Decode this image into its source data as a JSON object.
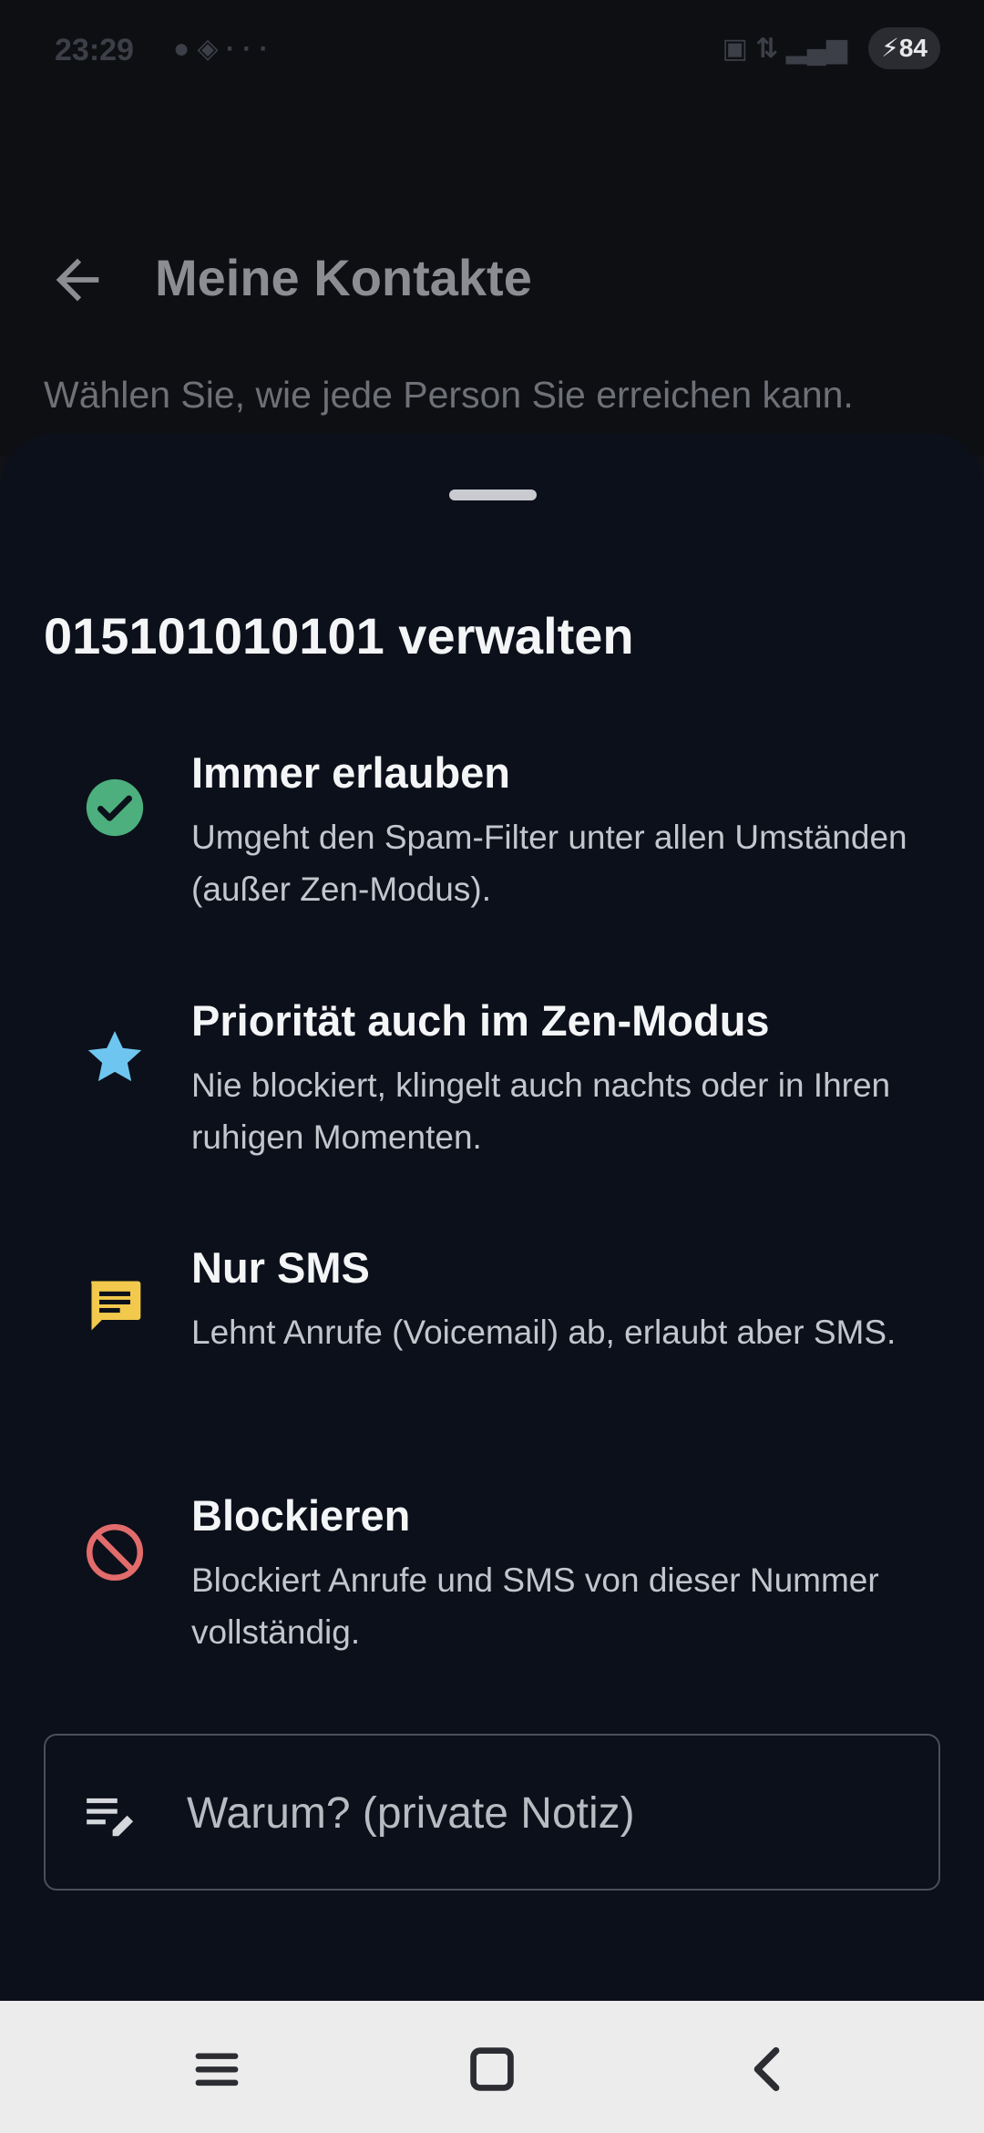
{
  "status_bar": {
    "time": "23:29",
    "battery": "84",
    "battery_icon": "bolt-icon"
  },
  "header": {
    "back_icon": "arrow-left-icon",
    "title": "Meine Kontakte",
    "subtitle": "Wählen Sie, wie jede Person Sie erreichen kann."
  },
  "sheet": {
    "title": "015101010101 verwalten",
    "options": [
      {
        "icon": "check-circle-icon",
        "title": "Immer erlauben",
        "description": "Umgeht den Spam-Filter unter allen Umständen (außer Zen-Modus).",
        "color": "#4caf7d"
      },
      {
        "icon": "star-icon",
        "title": "Priorität auch im Zen-Modus",
        "description": "Nie blockiert, klingelt auch nachts oder in Ihren ruhigen Momenten.",
        "color": "#6ec6f0"
      },
      {
        "icon": "message-icon",
        "title": "Nur SMS",
        "description": "Lehnt Anrufe (Voicemail) ab, erlaubt aber SMS.",
        "color": "#f2c94c"
      },
      {
        "icon": "block-icon",
        "title": "Blockieren",
        "description": "Blockiert Anrufe und SMS von dieser Nummer vollständig.",
        "color": "#e26b6b"
      }
    ],
    "note": {
      "icon": "edit-note-icon",
      "placeholder": "Warum? (private Notiz)"
    }
  },
  "nav_bar": {
    "menu_icon": "menu-icon",
    "home_icon": "square-icon",
    "back_icon": "chevron-left-icon"
  }
}
